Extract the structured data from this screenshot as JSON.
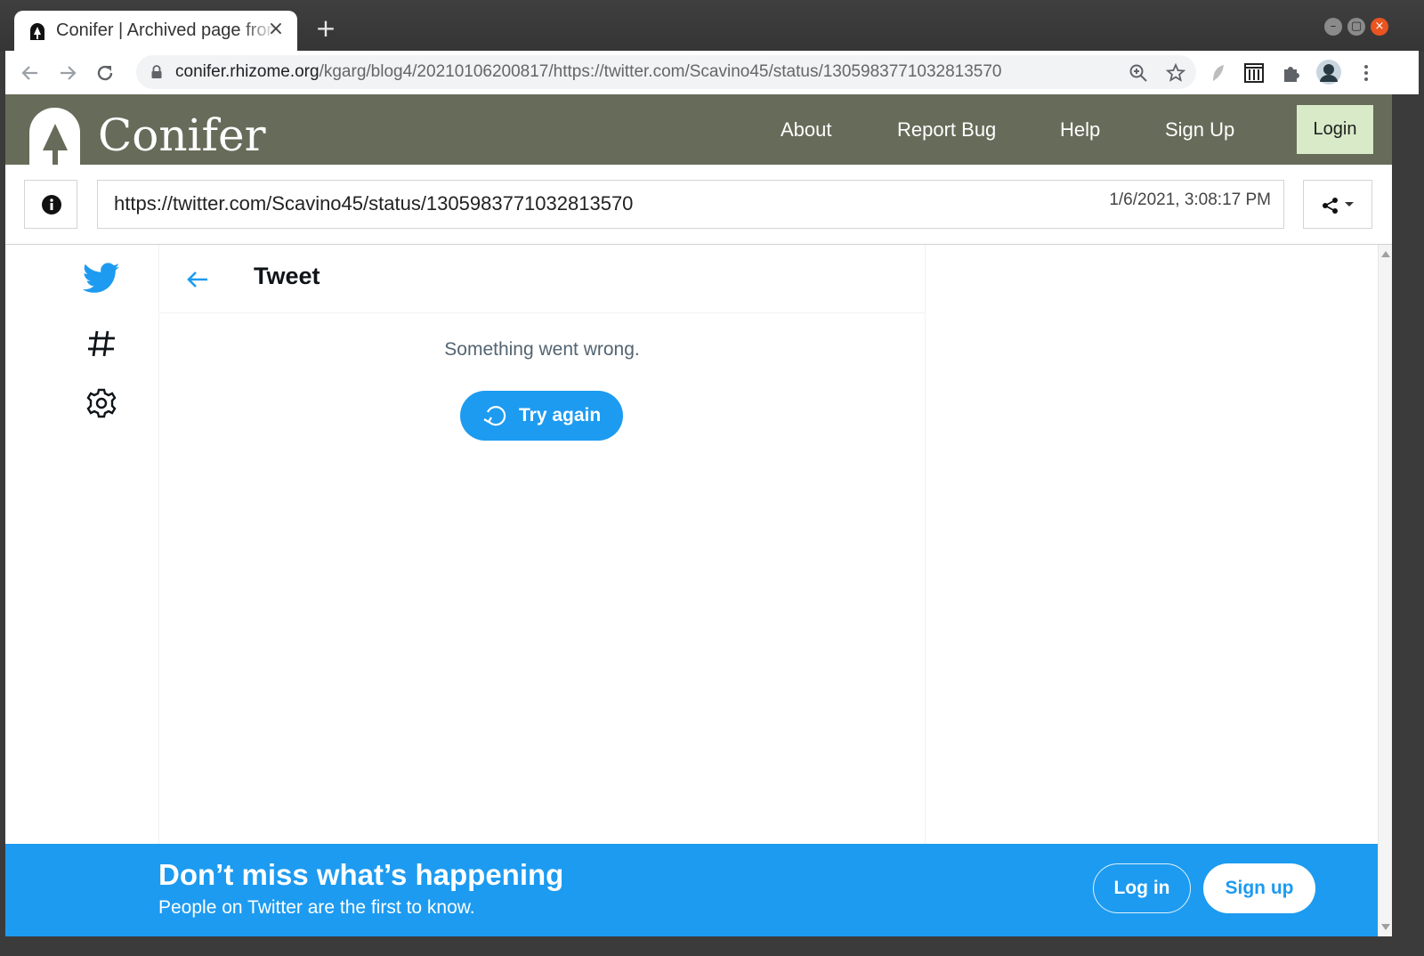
{
  "browser": {
    "tab_title": "Conifer | Archived page from",
    "tab_close": "×",
    "new_tab": "+",
    "url_host": "conifer.rhizome.org",
    "url_path": "/kgarg/blog4/20210106200817/https://twitter.com/Scavino45/status/1305983771032813570",
    "icons": {
      "back": "back-arrow-icon",
      "forward": "forward-arrow-icon",
      "reload": "reload-icon",
      "lock": "lock-icon",
      "zoom": "zoom-icon",
      "bookmark": "star-icon"
    }
  },
  "conifer": {
    "brand": "Conifer",
    "nav": {
      "about": "About",
      "report_bug": "Report Bug",
      "help": "Help",
      "sign_up": "Sign Up",
      "login": "Login"
    },
    "replay_url": "https://twitter.com/Scavino45/status/1305983771032813570",
    "replay_timestamp": "1/6/2021, 3:08:17 PM",
    "colors": {
      "header_bg": "#676b59",
      "login_bg": "#d8eac8"
    }
  },
  "twitter": {
    "page_title": "Tweet",
    "error_message": "Something went wrong.",
    "retry_label": "Try again",
    "banner": {
      "title": "Don’t miss what’s happening",
      "subtitle": "People on Twitter are the first to know.",
      "login_label": "Log in",
      "signup_label": "Sign up"
    },
    "colors": {
      "brand_blue": "#1d9bf0"
    }
  }
}
